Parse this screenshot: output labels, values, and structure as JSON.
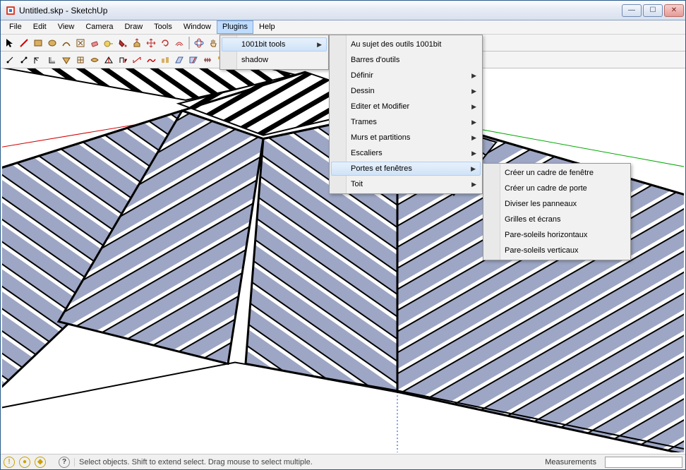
{
  "window": {
    "title": "Untitled.skp - SketchUp"
  },
  "menubar": {
    "items": [
      "File",
      "Edit",
      "View",
      "Camera",
      "Draw",
      "Tools",
      "Window",
      "Plugins",
      "Help"
    ],
    "activeIndex": 7
  },
  "pluginsMenu": {
    "items": [
      {
        "label": "1001bit tools",
        "submenu": true,
        "highlight": true
      },
      {
        "label": "shadow",
        "submenu": false,
        "highlight": false
      }
    ]
  },
  "toolsMenu": {
    "items": [
      {
        "label": "Au sujet des outils 1001bit",
        "submenu": false
      },
      {
        "label": "Barres d'outils",
        "submenu": false
      },
      {
        "label": "Définir",
        "submenu": true
      },
      {
        "label": "Dessin",
        "submenu": true
      },
      {
        "label": "Editer et Modifier",
        "submenu": true
      },
      {
        "label": "Trames",
        "submenu": true
      },
      {
        "label": "Murs et partitions",
        "submenu": true
      },
      {
        "label": "Escaliers",
        "submenu": true
      },
      {
        "label": "Portes et fenêtres",
        "submenu": true,
        "highlight": true
      },
      {
        "label": "Toit",
        "submenu": true
      }
    ]
  },
  "subMenu": {
    "items": [
      {
        "label": "Créer un cadre de fenêtre"
      },
      {
        "label": "Créer un cadre de porte"
      },
      {
        "label": "Diviser les panneaux"
      },
      {
        "label": "Grilles et écrans"
      },
      {
        "label": "Pare-soleils horizontaux"
      },
      {
        "label": "Pare-soleils verticaux"
      }
    ]
  },
  "status": {
    "hint": "Select objects. Shift to extend select. Drag mouse to select multiple.",
    "measurementsLabel": "Measurements"
  }
}
